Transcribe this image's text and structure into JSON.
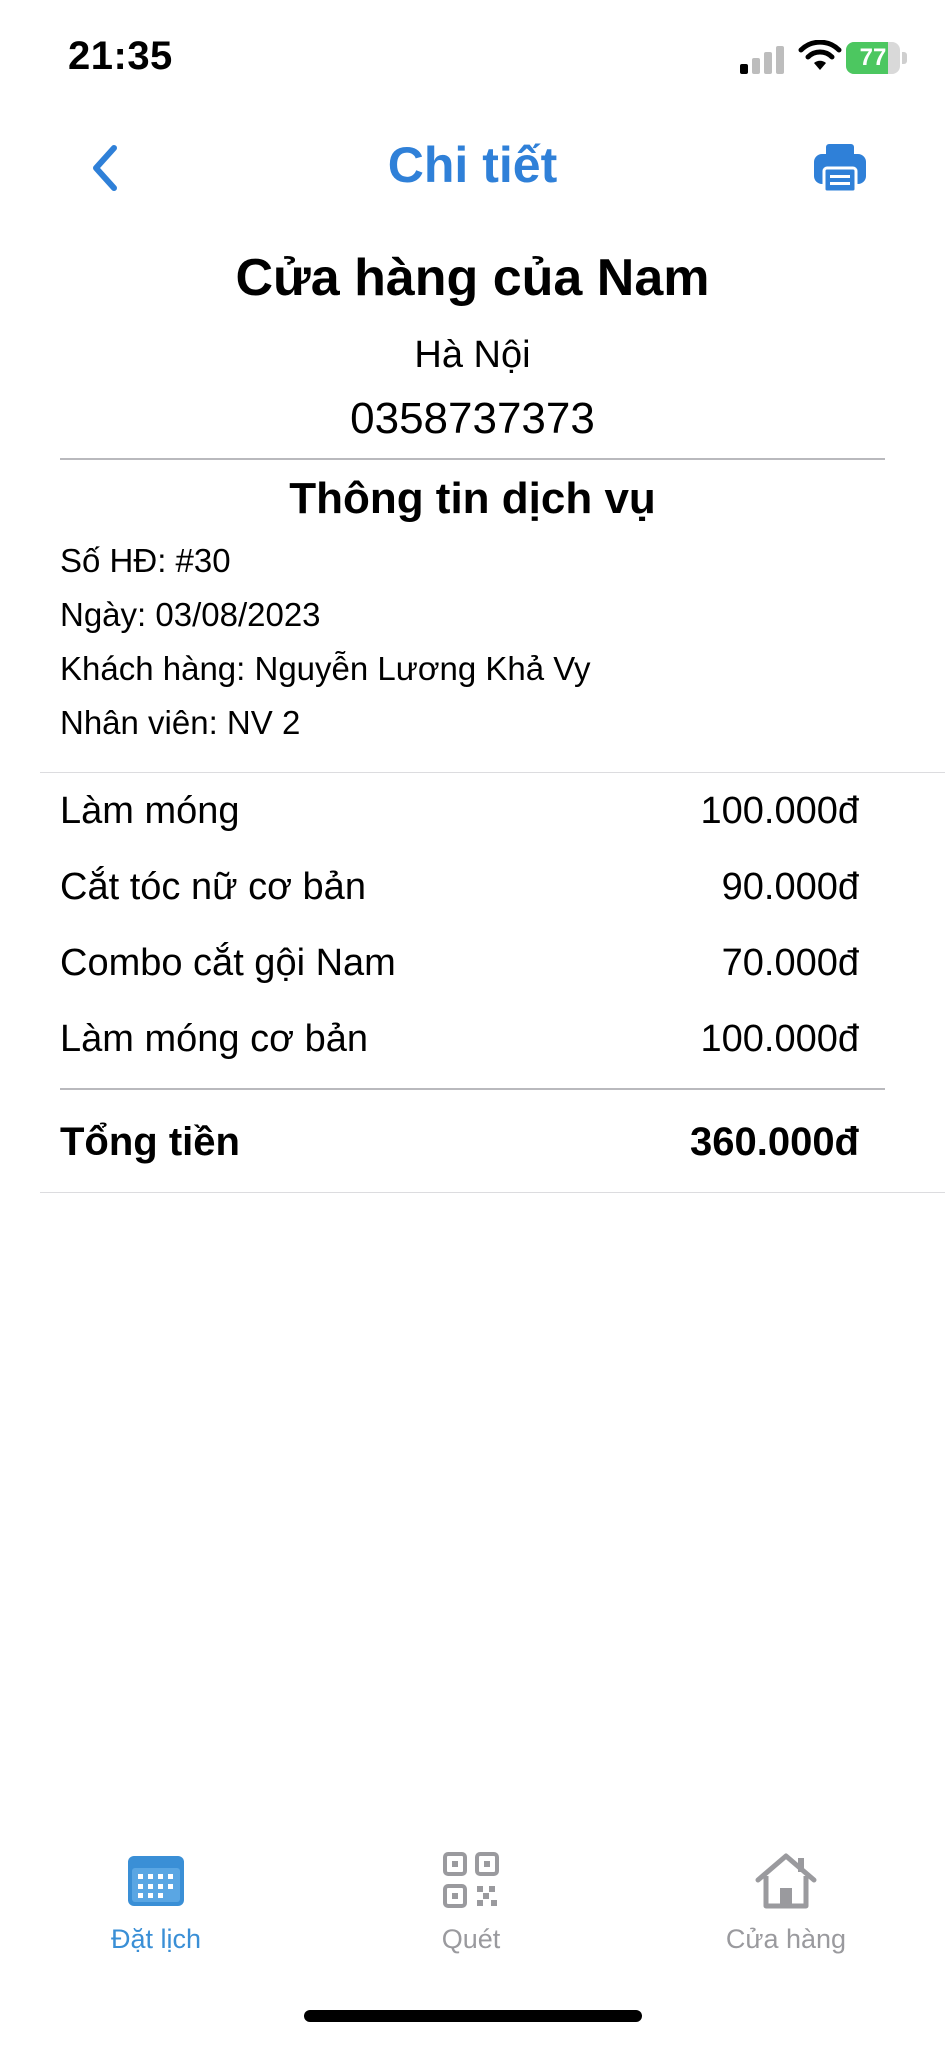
{
  "status_bar": {
    "time": "21:35",
    "battery": "77",
    "battery_level": 0.77
  },
  "nav": {
    "title": "Chi tiết",
    "back_icon": "chevron-left-icon",
    "print_icon": "printer-icon"
  },
  "store": {
    "name": "Cửa hàng của Nam",
    "city": "Hà Nội",
    "phone": "0358737373"
  },
  "service_info": {
    "title": "Thông tin dịch vụ",
    "invoice": "Số HĐ: #30",
    "date": "Ngày: 03/08/2023",
    "customer": "Khách hàng: Nguyễn Lương Khả Vy",
    "staff": "Nhân viên: NV 2"
  },
  "services": [
    {
      "name": "Làm móng",
      "price": "100.000đ"
    },
    {
      "name": "Cắt tóc nữ cơ bản",
      "price": "90.000đ"
    },
    {
      "name": "Combo cắt gội Nam",
      "price": "70.000đ"
    },
    {
      "name": "Làm móng cơ bản",
      "price": "100.000đ"
    }
  ],
  "total": {
    "label": "Tổng tiền",
    "value": "360.000đ"
  },
  "tabs": [
    {
      "label": "Đặt lịch",
      "icon": "calendar-icon",
      "active": true
    },
    {
      "label": "Quét",
      "icon": "qr-code-icon",
      "active": false
    },
    {
      "label": "Cửa hàng",
      "icon": "home-icon",
      "active": false
    }
  ],
  "colors": {
    "accent": "#2f80d8",
    "tab_active": "#3a8fd6",
    "tab_inactive": "#9a9a9e",
    "battery": "#4cc760"
  }
}
